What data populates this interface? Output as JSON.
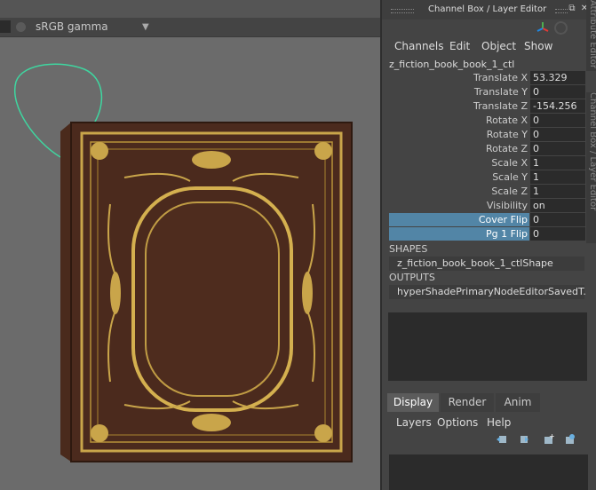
{
  "viewport": {
    "color_space": "sRGB gamma"
  },
  "panel": {
    "title": "Channel Box / Layer Editor",
    "side_tab_1": "Attribute Editor",
    "side_tab_2": "Channel Box / Layer Editor",
    "menu": [
      "Channels",
      "Edit",
      "Object",
      "Show"
    ],
    "node_name": "z_fiction_book_book_1_ctl",
    "attributes": [
      {
        "label": "Translate X",
        "value": "53.329"
      },
      {
        "label": "Translate Y",
        "value": "0"
      },
      {
        "label": "Translate Z",
        "value": "-154.256"
      },
      {
        "label": "Rotate X",
        "value": "0"
      },
      {
        "label": "Rotate Y",
        "value": "0"
      },
      {
        "label": "Rotate Z",
        "value": "0"
      },
      {
        "label": "Scale X",
        "value": "1"
      },
      {
        "label": "Scale Y",
        "value": "1"
      },
      {
        "label": "Scale Z",
        "value": "1"
      },
      {
        "label": "Visibility",
        "value": "on"
      },
      {
        "label": "Cover Flip",
        "value": "0"
      },
      {
        "label": "Pg 1 Flip",
        "value": "0"
      }
    ],
    "shapes_header": "SHAPES",
    "shapes_item": "z_fiction_book_book_1_ctlShape",
    "outputs_header": "OUTPUTS",
    "outputs_item": "hyperShadePrimaryNodeEditorSavedT...",
    "tabs": [
      "Display",
      "Render",
      "Anim"
    ],
    "layer_menu": [
      "Layers",
      "Options",
      "Help"
    ]
  },
  "colors": {
    "highlight": "#5285a6",
    "curve": "#3fd6a0"
  }
}
